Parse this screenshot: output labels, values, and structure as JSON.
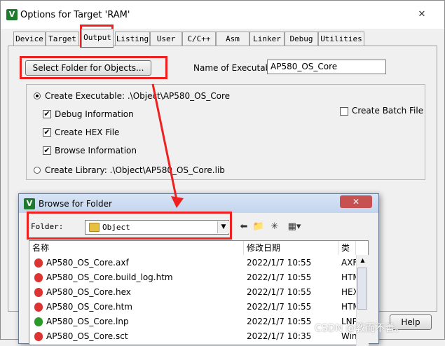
{
  "window": {
    "title": "Options for Target 'RAM'",
    "app_icon": "V",
    "close": "✕"
  },
  "tabs": [
    {
      "label": "Device",
      "active": false
    },
    {
      "label": "Target",
      "active": false
    },
    {
      "label": "Output",
      "active": true
    },
    {
      "label": "Listing",
      "active": false
    },
    {
      "label": "User",
      "active": false
    },
    {
      "label": "C/C++",
      "active": false
    },
    {
      "label": "Asm",
      "active": false
    },
    {
      "label": "Linker",
      "active": false
    },
    {
      "label": "Debug",
      "active": false
    },
    {
      "label": "Utilities",
      "active": false
    }
  ],
  "output": {
    "select_folder_label": "Select Folder for Objects...",
    "name_of_executable_label": "Name of Executable:",
    "executable_name": "AP580_OS_Core",
    "create_executable_label": "Create Executable:  .\\Object\\AP580_OS_Core",
    "debug_info_label": "Debug Information",
    "create_hex_label": "Create HEX File",
    "browse_info_label": "Browse Information",
    "create_library_label": "Create Library:  .\\Object\\AP580_OS_Core.lib",
    "create_batch_label": "Create Batch File",
    "help_label": "Help"
  },
  "browse": {
    "title": "Browse for Folder",
    "app_icon": "V",
    "folder_label": "Folder:",
    "folder_value": "Object",
    "columns": [
      "名称",
      "修改日期",
      "类型"
    ],
    "rows": [
      {
        "name": "AP580_OS_Core.axf",
        "date": "2022/1/7 10:55",
        "type": "AXF",
        "status": "err"
      },
      {
        "name": "AP580_OS_Core.build_log.htm",
        "date": "2022/1/7 10:55",
        "type": "HTM",
        "status": "err"
      },
      {
        "name": "AP580_OS_Core.hex",
        "date": "2022/1/7 10:55",
        "type": "HEX",
        "status": "err"
      },
      {
        "name": "AP580_OS_Core.htm",
        "date": "2022/1/7 10:55",
        "type": "HTM",
        "status": "err"
      },
      {
        "name": "AP580_OS_Core.lnp",
        "date": "2022/1/7 10:55",
        "type": "LNP",
        "status": "ok"
      },
      {
        "name": "AP580_OS_Core.sct",
        "date": "2022/1/7 10:35",
        "type": "Win",
        "status": "err"
      }
    ]
  },
  "watermark": "CSDN @教而不善。",
  "colors": {
    "annotation": "#ee2020",
    "title_bar": "#c3d5ee"
  }
}
